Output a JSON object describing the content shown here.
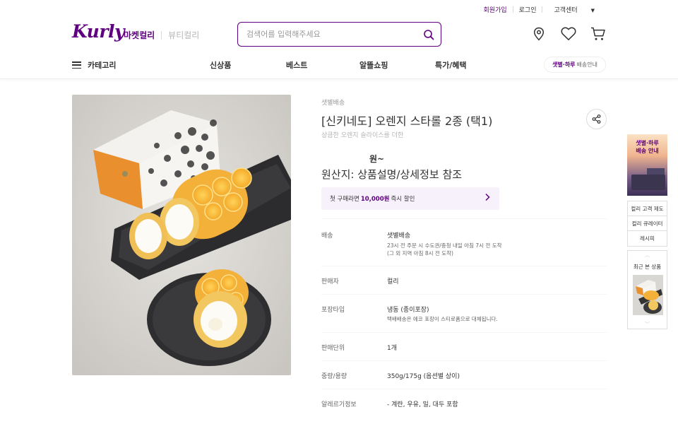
{
  "header": {
    "top_links": {
      "signup": "회원가입",
      "login": "로그인",
      "customer_center": "고객센터"
    },
    "logo": "Kurly",
    "market_tabs": {
      "active": "마켓컬리",
      "inactive": "뷰티컬리"
    },
    "search": {
      "placeholder": "검색어를 입력해주세요"
    },
    "icons": [
      "location-icon",
      "heart-icon",
      "cart-icon"
    ]
  },
  "gnb": {
    "category": "카테고리",
    "menus": [
      "신상품",
      "베스트",
      "알뜰쇼핑",
      "특가/혜택"
    ],
    "delivery_pill": {
      "highlight": "샛별·하루",
      "rest": "배송안내"
    }
  },
  "product": {
    "ship_type": "샛별배송",
    "title": "[신키네도] 오렌지 스타롤 2종 (택1)",
    "subtitle": "상큼한 오렌지 슬라이스를 더한",
    "price": "원~",
    "origin": "원산지: 상품설명/상세정보 참조",
    "coupon": {
      "prefix": "첫 구매라면",
      "amount": "10,000원",
      "suffix": "즉시 할인"
    }
  },
  "specs": [
    {
      "label": "배송",
      "value": "샛별배송",
      "sub": [
        "23시 전 주문 시 수도권/충청 내일 아침 7시 전 도착",
        "(그 외 지역 아침 8시 전 도착)"
      ]
    },
    {
      "label": "판매자",
      "value": "컬리",
      "sub": []
    },
    {
      "label": "포장타입",
      "value": "냉동 (종이포장)",
      "sub": [
        "택배배송은 에코 포장이 스티로폼으로 대체됩니다."
      ]
    },
    {
      "label": "판매단위",
      "value": "1개",
      "sub": []
    },
    {
      "label": "중량/용량",
      "value": "350g/175g (옵션별 상이)",
      "sub": []
    },
    {
      "label": "알레르기정보",
      "value": "- 계란, 우유, 밀, 대두 포함",
      "sub": []
    }
  ],
  "side": {
    "banner": [
      "샛별·하루",
      "배송 안내"
    ],
    "links": [
      "컬리 고객 제도",
      "컬리 큐레이터",
      "레시피"
    ],
    "recent_title": "최근 본 상품"
  },
  "colors": {
    "brand": "#5f0080",
    "coupon_bg": "#f6f1fa"
  }
}
